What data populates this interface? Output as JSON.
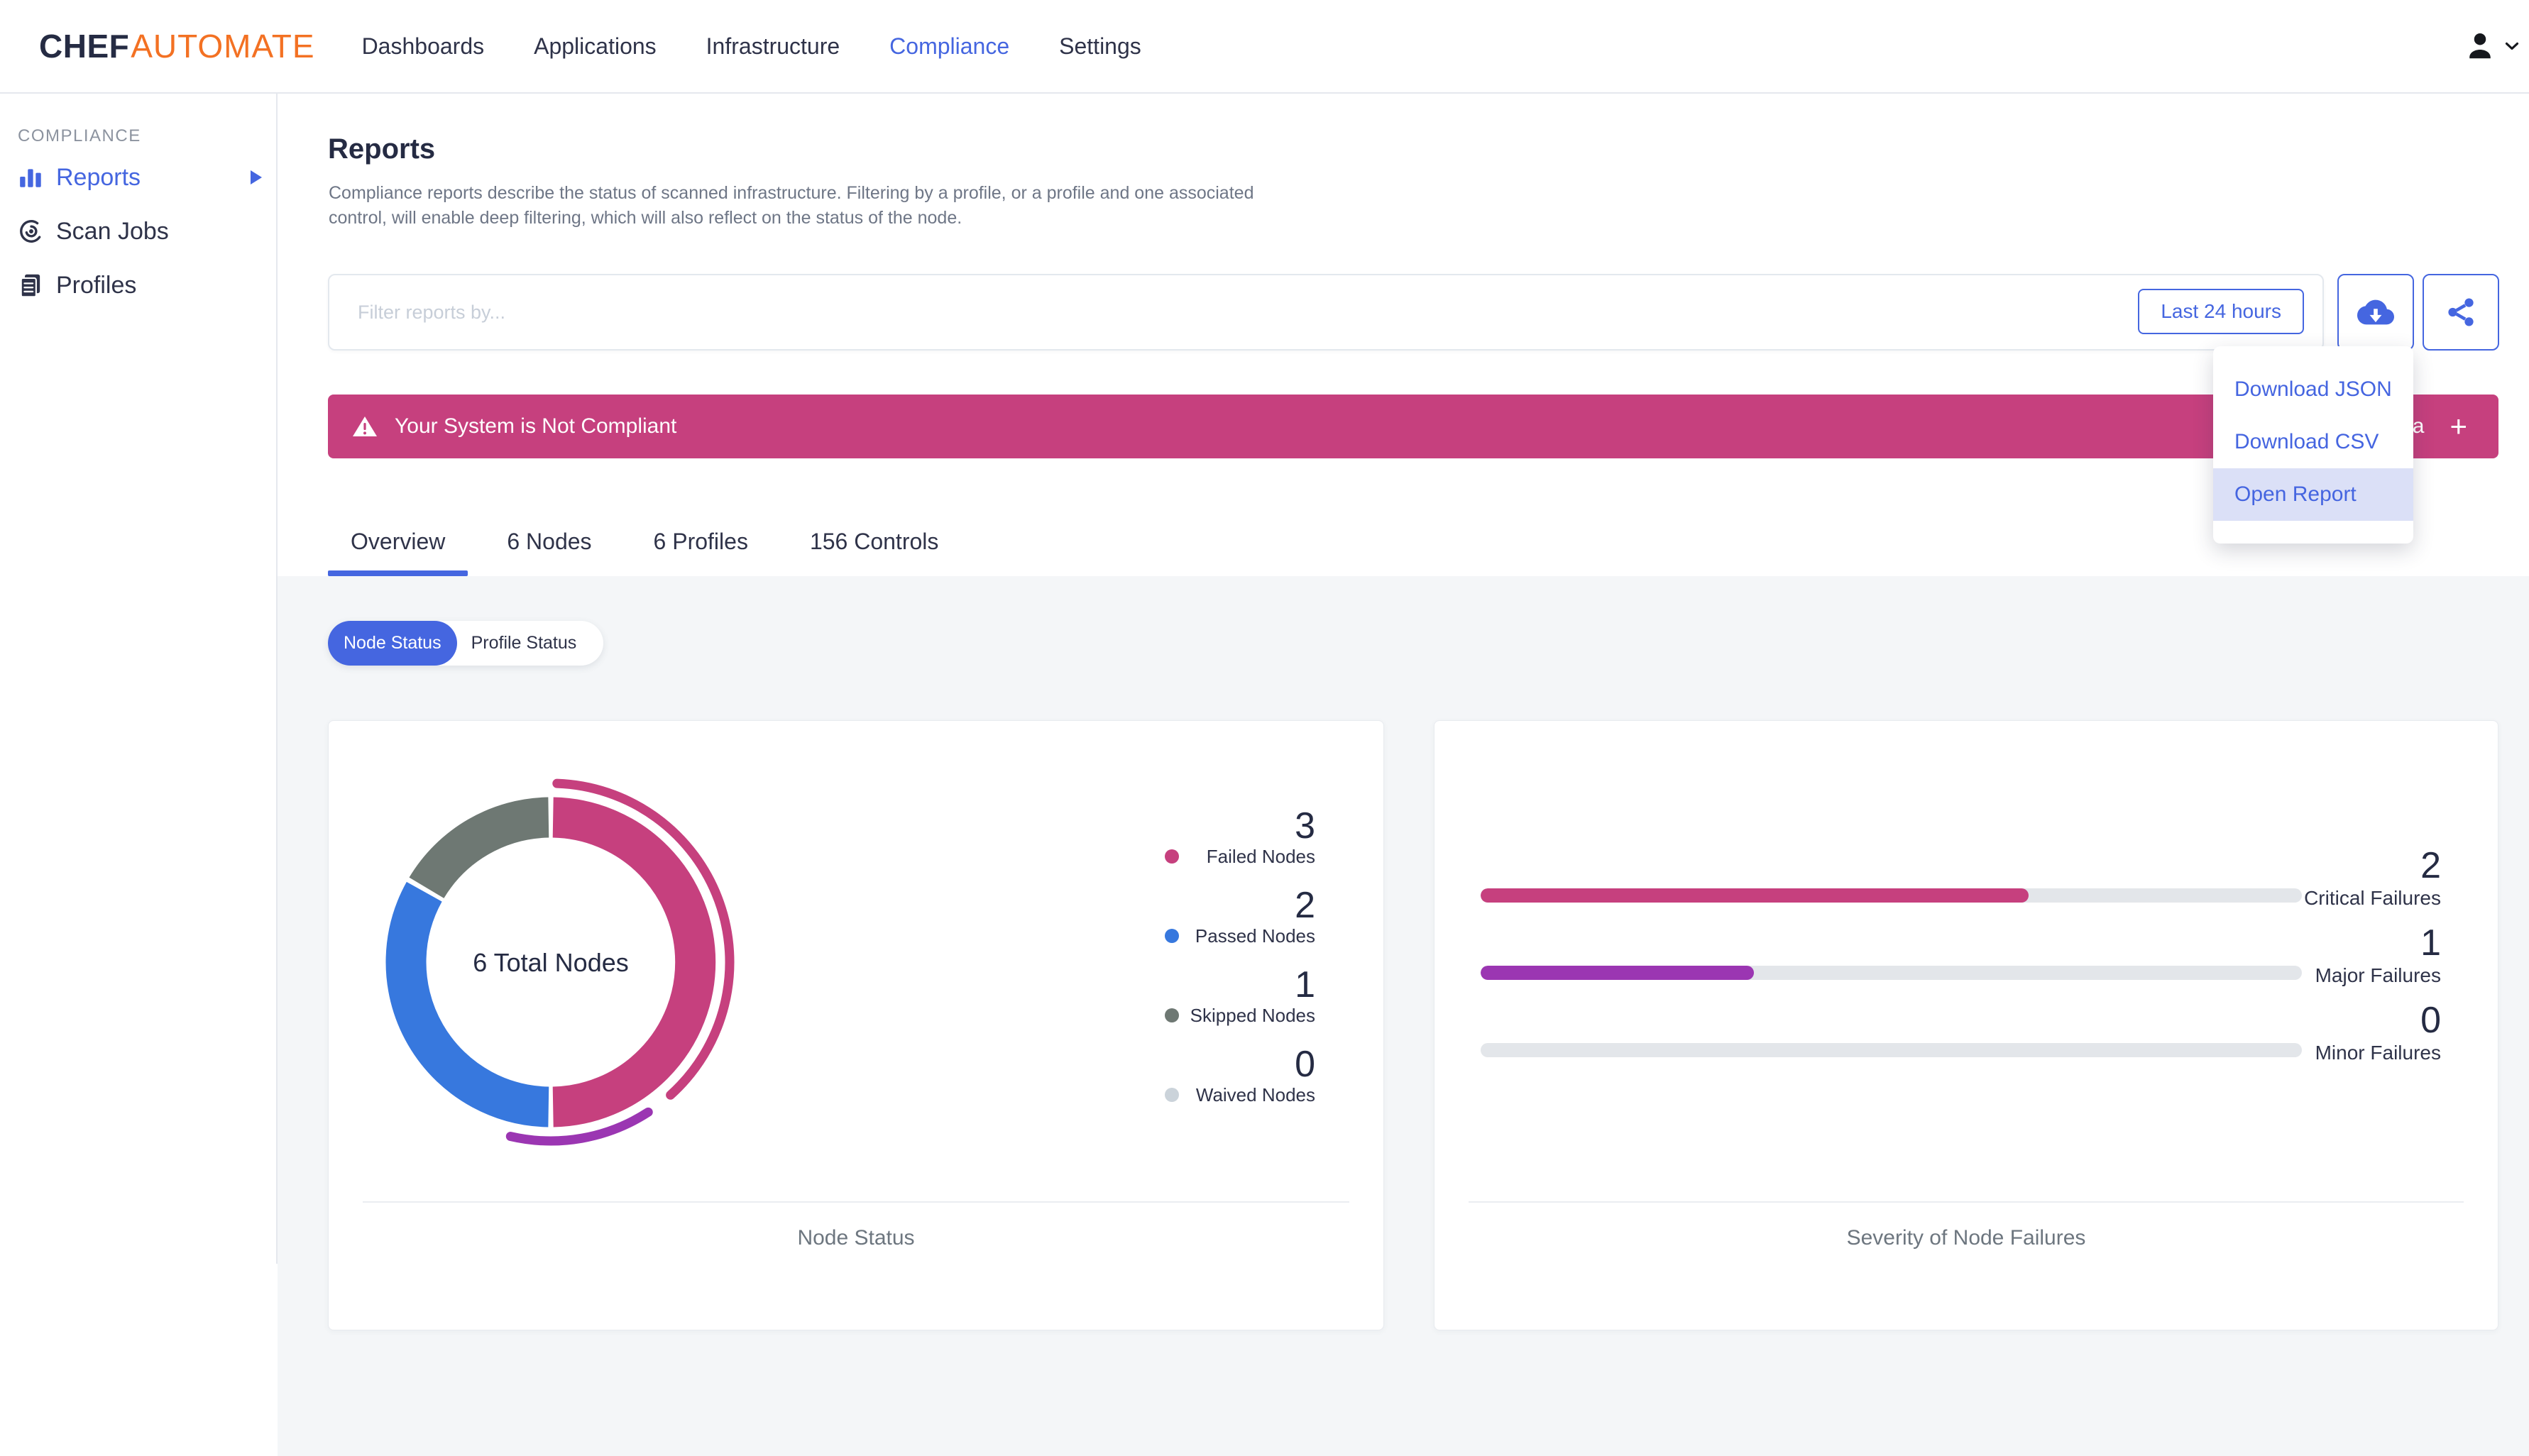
{
  "header": {
    "brand": {
      "chef": "CHEF",
      "automate": "AUTOMATE"
    },
    "nav_items": [
      {
        "label": "Dashboards",
        "active": false
      },
      {
        "label": "Applications",
        "active": false
      },
      {
        "label": "Infrastructure",
        "active": false
      },
      {
        "label": "Compliance",
        "active": true
      },
      {
        "label": "Settings",
        "active": false
      }
    ],
    "user_icon": "user-avatar-icon",
    "user_caret": "chevron-down-icon"
  },
  "sidebar": {
    "section_label": "COMPLIANCE",
    "items": [
      {
        "label": "Reports",
        "icon": "bar-chart-icon",
        "active": true,
        "has_arrow": true
      },
      {
        "label": "Scan Jobs",
        "icon": "radar-icon",
        "active": false,
        "has_arrow": false
      },
      {
        "label": "Profiles",
        "icon": "documents-icon",
        "active": false,
        "has_arrow": false
      }
    ]
  },
  "page": {
    "title": "Reports",
    "description": "Compliance reports describe the status of scanned infrastructure. Filtering by a profile, or a profile and one associated control, will enable deep filtering, which will also reflect on the status of the node."
  },
  "filter_bar": {
    "placeholder": "Filter reports by...",
    "time_range_label": "Last 24 hours",
    "download_icon": "cloud-download-icon",
    "share_icon": "share-icon"
  },
  "download_menu": {
    "items": [
      {
        "label": "Download JSON",
        "highlighted": false
      },
      {
        "label": "Download CSV",
        "highlighted": false
      },
      {
        "label": "Open Report",
        "highlighted": true
      }
    ]
  },
  "banner": {
    "message": "Your System is Not Compliant",
    "icon": "warning-triangle-icon",
    "action_label": "Add Data",
    "action_plus": "+",
    "color": "#C6407E"
  },
  "tabs": [
    {
      "label": "Overview",
      "active": true
    },
    {
      "label": "6 Nodes",
      "active": false
    },
    {
      "label": "6 Profiles",
      "active": false
    },
    {
      "label": "156 Controls",
      "active": false
    }
  ],
  "status_toggle": {
    "options": [
      {
        "label": "Node Status",
        "active": true
      },
      {
        "label": "Profile Status",
        "active": false
      }
    ]
  },
  "chart_data": [
    {
      "type": "donut",
      "title": "Node Status",
      "center_label": "6 Total Nodes",
      "total_nodes": 6,
      "segments": [
        {
          "label": "Failed Nodes",
          "value": 3,
          "color": "#C6407E"
        },
        {
          "label": "Passed Nodes",
          "value": 2,
          "color": "#3778DE"
        },
        {
          "label": "Skipped Nodes",
          "value": 1,
          "color": "#6E7873"
        },
        {
          "label": "Waived Nodes",
          "value": 0,
          "color": "#CBD3DA"
        }
      ],
      "outer_arcs": [
        {
          "label": "Critical",
          "color": "#C6407E",
          "start_deg": 2,
          "end_deg": 138
        },
        {
          "label": "Major",
          "color": "#9B36B2",
          "start_deg": 147,
          "end_deg": 193
        }
      ],
      "legend_position": "right"
    },
    {
      "type": "bar",
      "title": "Severity of Node Failures",
      "orientation": "horizontal",
      "max": 3,
      "bars": [
        {
          "label": "Critical Failures",
          "value": 2,
          "color": "#C6407E"
        },
        {
          "label": "Major Failures",
          "value": 1,
          "color": "#9B36B2"
        },
        {
          "label": "Minor Failures",
          "value": 0,
          "color": "#E3E6EA"
        }
      ]
    }
  ],
  "colors": {
    "accent": "#4566E0",
    "banner_pink": "#C6407E",
    "purple": "#9B36B2",
    "content_bg": "#F4F6F8",
    "menu_highlight": "#DBE0F7",
    "bar_track": "#E3E6EA"
  }
}
